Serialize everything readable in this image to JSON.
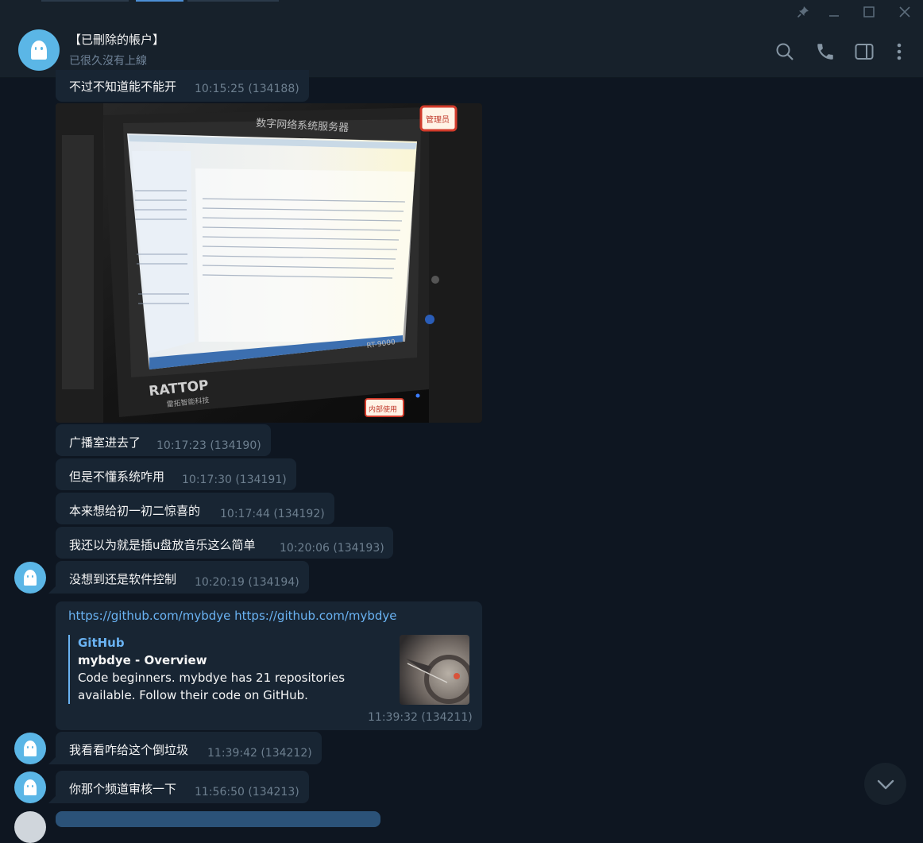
{
  "header": {
    "title": "【已刪除的帳户】",
    "status": "已很久沒有上線"
  },
  "messages": [
    {
      "text": "不过不知道能不能开",
      "time": "10:15:25 (134188)"
    },
    {
      "text": "广播室进去了",
      "time": "10:17:23 (134190)"
    },
    {
      "text": "但是不懂系统咋用",
      "time": "10:17:30 (134191)"
    },
    {
      "text": "本来想给初一初二惊喜的",
      "time": "10:17:44 (134192)"
    },
    {
      "text": "我还以为就是插u盘放音乐这么简单",
      "time": "10:20:06 (134193)"
    },
    {
      "text": "没想到还是软件控制",
      "time": "10:20:19 (134194)"
    },
    {
      "text": "我看看咋给这个倒垃圾",
      "time": "11:39:42 (134212)"
    },
    {
      "text": "你那个频道审核一下",
      "time": "11:56:50 (134213)"
    }
  ],
  "photo": {
    "screen_title": "数字网络系统服务器",
    "brand": "RATTOP",
    "brand_sub": "雷拓智能科技",
    "model": "RT-9000",
    "tag_top": "管理员",
    "tag_bottom": "内部使用"
  },
  "link_message": {
    "url1": "https://github.com/mybdye",
    "url2": "https://github.com/mybdye",
    "site": "GitHub",
    "title": "mybdye - Overview",
    "desc_line1": "Code beginners. mybdye has 21 repositories",
    "desc_line2": "available. Follow their code on GitHub.",
    "time": "11:39:32 (134211)"
  },
  "colors": {
    "background": "#0e1621",
    "bubble": "#182533",
    "header": "#17212b",
    "link": "#6ab3f3",
    "time": "#6d7f8f",
    "avatar": "#5bb6e6"
  },
  "icons": [
    "pin-icon",
    "minimize-icon",
    "maximize-icon",
    "close-icon",
    "search-icon",
    "phone-icon",
    "sidebar-icon",
    "more-icon",
    "chevron-down-icon",
    "ghost-avatar-icon"
  ]
}
